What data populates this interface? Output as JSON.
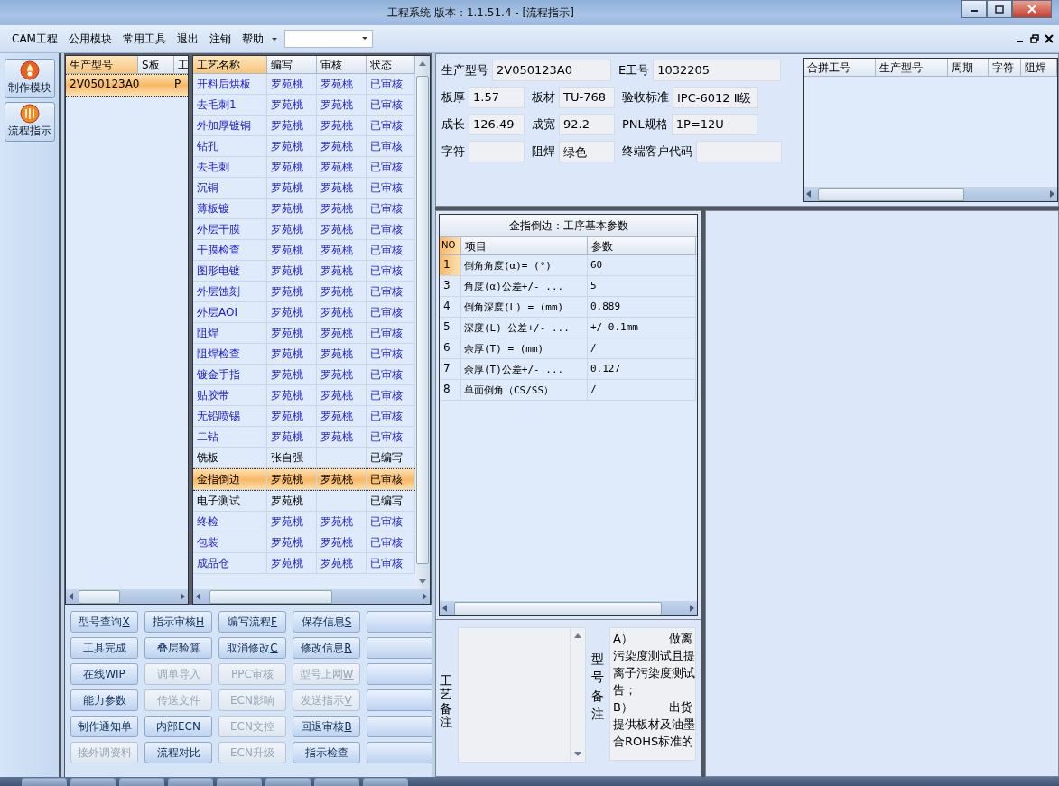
{
  "window": {
    "title": "工程系统   版本：1.1.51.4 - [流程指示]"
  },
  "menu": [
    "CAM工程",
    "公用模块",
    "常用工具",
    "退出",
    "注销",
    "帮助"
  ],
  "nav": [
    {
      "label": "制作模块",
      "kind": "flame"
    },
    {
      "label": "流程指示",
      "kind": "orb"
    }
  ],
  "model_list": {
    "columns": [
      {
        "label": "生产型号",
        "sorted": true
      },
      {
        "label": "S板",
        "sorted": false
      },
      {
        "label": "工",
        "sorted": false
      }
    ],
    "rows": [
      {
        "model": "2V050123A0",
        "column_3": "P",
        "selected": true
      }
    ]
  },
  "process_table": {
    "columns": [
      {
        "label": "工艺名称",
        "sorted": true
      },
      {
        "label": "编写",
        "sorted": false
      },
      {
        "label": "审核",
        "sorted": false
      },
      {
        "label": "状态",
        "sorted": false
      }
    ],
    "rows": [
      {
        "name": "开料后烘板",
        "writer": "罗苑桃",
        "reviewer": "罗苑桃",
        "status": "已审核",
        "reviewed": true,
        "selected": false
      },
      {
        "name": "去毛刺1",
        "writer": "罗苑桃",
        "reviewer": "罗苑桃",
        "status": "已审核",
        "reviewed": true,
        "selected": false
      },
      {
        "name": "外加厚镀铜",
        "writer": "罗苑桃",
        "reviewer": "罗苑桃",
        "status": "已审核",
        "reviewed": true,
        "selected": false
      },
      {
        "name": "钻孔",
        "writer": "罗苑桃",
        "reviewer": "罗苑桃",
        "status": "已审核",
        "reviewed": true,
        "selected": false
      },
      {
        "name": "去毛刺",
        "writer": "罗苑桃",
        "reviewer": "罗苑桃",
        "status": "已审核",
        "reviewed": true,
        "selected": false
      },
      {
        "name": "沉铜",
        "writer": "罗苑桃",
        "reviewer": "罗苑桃",
        "status": "已审核",
        "reviewed": true,
        "selected": false
      },
      {
        "name": "薄板镀",
        "writer": "罗苑桃",
        "reviewer": "罗苑桃",
        "status": "已审核",
        "reviewed": true,
        "selected": false
      },
      {
        "name": "外层干膜",
        "writer": "罗苑桃",
        "reviewer": "罗苑桃",
        "status": "已审核",
        "reviewed": true,
        "selected": false
      },
      {
        "name": "干膜检查",
        "writer": "罗苑桃",
        "reviewer": "罗苑桃",
        "status": "已审核",
        "reviewed": true,
        "selected": false
      },
      {
        "name": "图形电镀",
        "writer": "罗苑桃",
        "reviewer": "罗苑桃",
        "status": "已审核",
        "reviewed": true,
        "selected": false
      },
      {
        "name": "外层蚀刻",
        "writer": "罗苑桃",
        "reviewer": "罗苑桃",
        "status": "已审核",
        "reviewed": true,
        "selected": false
      },
      {
        "name": "外层AOI",
        "writer": "罗苑桃",
        "reviewer": "罗苑桃",
        "status": "已审核",
        "reviewed": true,
        "selected": false
      },
      {
        "name": "阻焊",
        "writer": "罗苑桃",
        "reviewer": "罗苑桃",
        "status": "已审核",
        "reviewed": true,
        "selected": false
      },
      {
        "name": "阻焊检查",
        "writer": "罗苑桃",
        "reviewer": "罗苑桃",
        "status": "已审核",
        "reviewed": true,
        "selected": false
      },
      {
        "name": "镀金手指",
        "writer": "罗苑桃",
        "reviewer": "罗苑桃",
        "status": "已审核",
        "reviewed": true,
        "selected": false
      },
      {
        "name": "贴胶带",
        "writer": "罗苑桃",
        "reviewer": "罗苑桃",
        "status": "已审核",
        "reviewed": true,
        "selected": false
      },
      {
        "name": "无铅喷锡",
        "writer": "罗苑桃",
        "reviewer": "罗苑桃",
        "status": "已审核",
        "reviewed": true,
        "selected": false
      },
      {
        "name": "二钻",
        "writer": "罗苑桃",
        "reviewer": "罗苑桃",
        "status": "已审核",
        "reviewed": true,
        "selected": false
      },
      {
        "name": "铣板",
        "writer": "张自强",
        "status": "已编写",
        "reviewed": false,
        "selected": false
      },
      {
        "name": "金指倒边",
        "writer": "罗苑桃",
        "reviewer": "罗苑桃",
        "status": "已审核",
        "reviewed": true,
        "selected": true
      },
      {
        "name": "电子测试",
        "writer": "罗苑桃",
        "status": "已编写",
        "reviewed": false,
        "selected": false
      },
      {
        "name": "终检",
        "writer": "罗苑桃",
        "reviewer": "罗苑桃",
        "status": "已审核",
        "reviewed": true,
        "selected": false
      },
      {
        "name": "包装",
        "writer": "罗苑桃",
        "reviewer": "罗苑桃",
        "status": "已审核",
        "reviewed": true,
        "selected": false
      },
      {
        "name": "成品仓",
        "writer": "罗苑桃",
        "reviewer": "罗苑桃",
        "status": "已审核",
        "reviewed": true,
        "selected": false
      }
    ]
  },
  "buttons": [
    [
      {
        "label": "型号查询",
        "key": "X",
        "disabled": false
      },
      {
        "label": "指示审核",
        "key": "H",
        "disabled": false
      },
      {
        "label": "编写流程",
        "key": "F",
        "disabled": false
      },
      {
        "label": "保存信息",
        "key": "S",
        "disabled": false
      }
    ],
    [
      {
        "label": "工具完成",
        "disabled": false
      },
      {
        "label": "叠层验算",
        "disabled": false
      },
      {
        "label": "取消修改",
        "key": "C",
        "disabled": false
      },
      {
        "label": "修改信息",
        "key": "R",
        "disabled": false
      }
    ],
    [
      {
        "label": "在线WIP",
        "disabled": false
      },
      {
        "label": "调单导入",
        "disabled": true
      },
      {
        "label": "PPC审核",
        "disabled": true
      },
      {
        "label": "型号上网",
        "key": "W",
        "disabled": true
      }
    ],
    [
      {
        "label": "能力参数",
        "disabled": false
      },
      {
        "label": "传送文件",
        "disabled": true
      },
      {
        "label": "ECN影响",
        "disabled": true
      },
      {
        "label": "发送指示",
        "key": "V",
        "disabled": true
      }
    ],
    [
      {
        "label": "制作通知单",
        "disabled": false
      },
      {
        "label": "内部ECN",
        "disabled": false
      },
      {
        "label": "ECN文控",
        "disabled": true
      },
      {
        "label": "回退审核",
        "key": "B",
        "disabled": false
      }
    ],
    [
      {
        "label": "接外调资料",
        "disabled": true
      },
      {
        "label": "流程对比",
        "disabled": false
      },
      {
        "label": "ECN升级",
        "disabled": true
      },
      {
        "label": "指示检查",
        "disabled": false
      }
    ]
  ],
  "info_fields": [
    [
      {
        "label": "生产型号",
        "value": "2V050123A0"
      },
      {
        "label": "E工号",
        "value": "1032205"
      }
    ],
    [
      {
        "label": "板厚",
        "value": "1.57"
      },
      {
        "label": "板材",
        "value": "TU-768"
      },
      {
        "label": "验收标准",
        "value": "IPC-6012 Ⅱ级"
      }
    ],
    [
      {
        "label": "成长",
        "value": "126.49"
      },
      {
        "label": "成宽",
        "value": "92.2"
      },
      {
        "label": "PNL规格",
        "value": "1P=12U"
      }
    ],
    [
      {
        "label": "字符"
      },
      {
        "label": "阻焊",
        "value": "绿色"
      },
      {
        "label": "终端客户代码"
      }
    ]
  ],
  "merge_table": {
    "columns": [
      "合拼工号",
      "生产型号",
      "周期",
      "字符",
      "阻焊"
    ]
  },
  "param_table": {
    "title": "金指倒边：工序基本参数",
    "columns": [
      "NO",
      "项目",
      "参数"
    ],
    "rows": [
      {
        "no": "1",
        "item": "倒角角度(α)=  (°)",
        "value": "60",
        "selected": true
      },
      {
        "no": "3",
        "item": "角度(α)公差+/- ...",
        "value": "5",
        "selected": false
      },
      {
        "no": "4",
        "item": "倒角深度(L) =  (mm)",
        "value": "0.889",
        "selected": false
      },
      {
        "no": "5",
        "item": "深度(L) 公差+/- ...",
        "value": "+/-0.1mm",
        "selected": false
      },
      {
        "no": "6",
        "item": "余厚(T) =  (mm)",
        "value": "/",
        "selected": false
      },
      {
        "no": "7",
        "item": "余厚(T)公差+/-  ...",
        "value": "0.127",
        "selected": false
      },
      {
        "no": "8",
        "item": "单面倒角（CS/SS）",
        "value": "/",
        "selected": false
      }
    ]
  },
  "remarks": {
    "process_label": "工艺备注",
    "model_label": "型号备注",
    "model_lines": [
      "A）",
      "做离",
      "污染度测试且提",
      "离子污染度测试",
      "告；",
      "B）",
      "出货",
      "提供板材及油墨",
      "合ROHS标准的"
    ]
  }
}
